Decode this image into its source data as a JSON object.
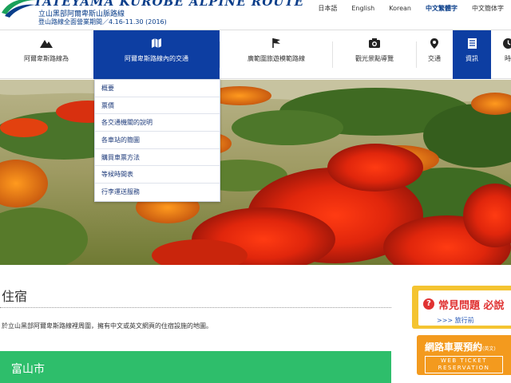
{
  "header": {
    "logo_title": "TATEYAMA KUROBE ALPINE ROUTE",
    "logo_sub1": "立山黑部阿爾卑斯山脈路線",
    "logo_sub2": "登山路線全面營業期間／4.16-11.30 (2016)"
  },
  "languages": [
    {
      "label": "日本語",
      "active": false
    },
    {
      "label": "English",
      "active": false
    },
    {
      "label": "Korean",
      "active": false
    },
    {
      "label": "中文繁體字",
      "active": true
    },
    {
      "label": "中文簡体字",
      "active": false
    }
  ],
  "nav": [
    {
      "label": "阿爾卑斯路線為",
      "icon": "mountain-icon",
      "state": "normal"
    },
    {
      "label": "阿爾卑斯路線內的交通",
      "icon": "map-icon",
      "state": "open"
    },
    {
      "label": "廣範圍旅遊模範路線",
      "icon": "flag-icon",
      "state": "normal"
    },
    {
      "label": "觀光景點導覽",
      "icon": "camera-icon",
      "state": "normal"
    },
    {
      "label": "交通",
      "icon": "location-pin-icon",
      "state": "normal"
    },
    {
      "label": "資訊",
      "icon": "document-icon",
      "state": "current"
    },
    {
      "label": "時",
      "icon": "clock-icon",
      "state": "normal"
    }
  ],
  "dropdown": [
    "概要",
    "票價",
    "各交通機關的說明",
    "各車站的簡圖",
    "購買車票方法",
    "等候時間表",
    "行李運送服務"
  ],
  "content": {
    "title": "住宿",
    "intro": "於立山黑部阿爾卑斯路線裡周圍，擁有中文或英文網頁的住宿設施的地圖。",
    "city": "富山市"
  },
  "sidebar": {
    "faq_q": "?",
    "faq_title": "常見問題 必說",
    "faq_sub": ">>> 旅行前",
    "ticket_title": "網路車票預約",
    "ticket_title_small": "(英文)",
    "ticket_en": "WEB TICKET RESERVATION"
  },
  "colors": {
    "brand_blue": "#0d3ea2",
    "city_green": "#2ebe6b",
    "faq_yellow": "#f4c431",
    "ticket_orange": "#f39a1e",
    "faq_red": "#e03232"
  }
}
